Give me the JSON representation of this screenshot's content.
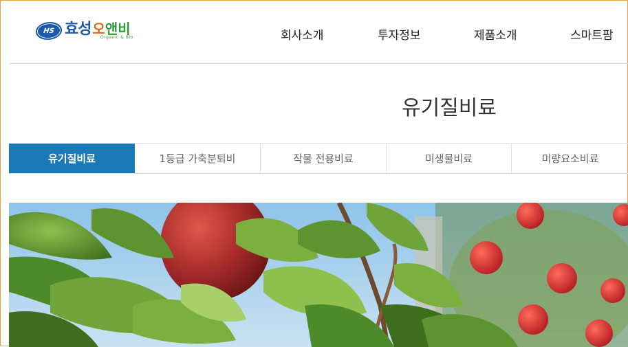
{
  "logo": {
    "badge": "HS",
    "name_part1": "효성",
    "name_part2": "오",
    "name_part3": "앤비",
    "subtitle": "Organic & Bio"
  },
  "nav": {
    "items": [
      "회사소개",
      "투자정보",
      "제품소개",
      "스마트팜"
    ]
  },
  "page": {
    "title": "유기질비료"
  },
  "tabs": {
    "items": [
      "유기질비료",
      "1등급 가축분퇴비",
      "작물 전용비료",
      "미생물비료",
      "미량요소비료"
    ],
    "active_index": 0
  },
  "colors": {
    "accent": "#1a7ab8",
    "brand_blue": "#1f5aa8",
    "brand_orange": "#e06a1a",
    "brand_green": "#2f9a3a"
  },
  "hero": {
    "image_subject": "apples-on-tree"
  }
}
